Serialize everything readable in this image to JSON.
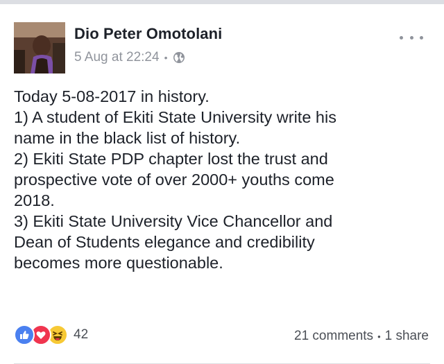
{
  "post": {
    "author": "Dio Peter Omotolani",
    "timestamp": "5 Aug at 22:24",
    "separator": "•",
    "privacy_icon": "globe-icon",
    "more_icon": "more-options-icon",
    "lines": [
      "Today 5-08-2017 in history.",
      "1) A student of Ekiti State University write his",
      "name in the black list of history.",
      "2) Ekiti State PDP chapter lost the trust and",
      "prospective vote of over 2000+ youths come",
      "2018.",
      "3) Ekiti State University Vice Chancellor and",
      "Dean of Students elegance and credibility",
      "becomes more questionable."
    ]
  },
  "footer": {
    "reaction_icons": [
      "like-icon",
      "love-icon",
      "haha-icon"
    ],
    "reaction_count": "42",
    "comments": "21 comments",
    "separator": "•",
    "shares": "1 share"
  },
  "colors": {
    "text": "#1d2129",
    "meta": "#90949c",
    "like": "#4a80f0",
    "love": "#f0354f",
    "haha": "#f7c935"
  }
}
